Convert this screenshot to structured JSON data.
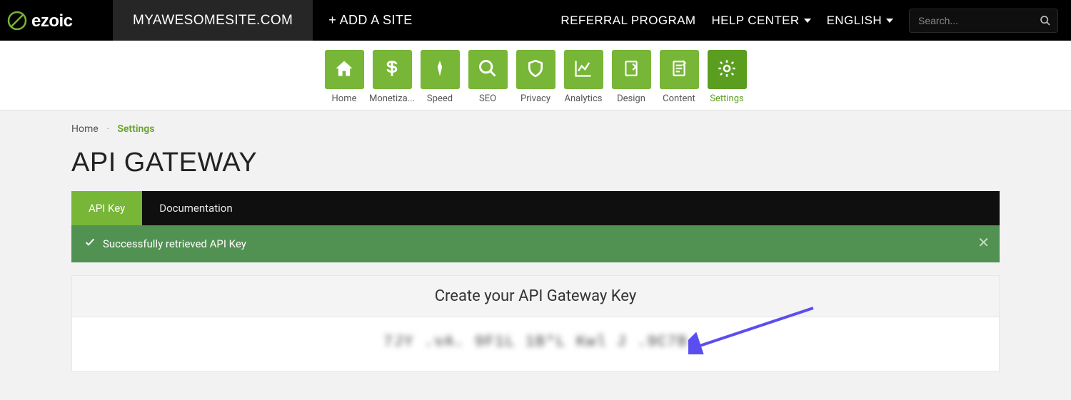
{
  "brand": "ezoic",
  "header": {
    "site": "MYAWESOMESITE.COM",
    "add_site": "+ ADD A SITE",
    "links": {
      "referral": "REFERRAL PROGRAM",
      "help": "HELP CENTER",
      "language": "ENGLISH"
    },
    "search_placeholder": "Search..."
  },
  "nav": {
    "items": [
      {
        "label": "Home",
        "icon": "home"
      },
      {
        "label": "Monetiza...",
        "icon": "dollar"
      },
      {
        "label": "Speed",
        "icon": "rocket"
      },
      {
        "label": "SEO",
        "icon": "magnify"
      },
      {
        "label": "Privacy",
        "icon": "shield"
      },
      {
        "label": "Analytics",
        "icon": "chart"
      },
      {
        "label": "Design",
        "icon": "design"
      },
      {
        "label": "Content",
        "icon": "content"
      },
      {
        "label": "Settings",
        "icon": "gear"
      }
    ],
    "active_index": 8
  },
  "breadcrumb": {
    "home": "Home",
    "current": "Settings"
  },
  "page": {
    "title": "API GATEWAY",
    "tabs": [
      {
        "label": "API Key"
      },
      {
        "label": "Documentation"
      }
    ],
    "active_tab": 0,
    "alert": "Successfully retrieved API Key",
    "panel_title": "Create your API Gateway Key",
    "api_key_masked": "7JY  .vA.  9F1L  1B*L  Kwl  J  .9C7B"
  },
  "colors": {
    "brand_green": "#77b637",
    "brand_green_dark": "#5b9e1f",
    "alert_green": "#519151"
  }
}
